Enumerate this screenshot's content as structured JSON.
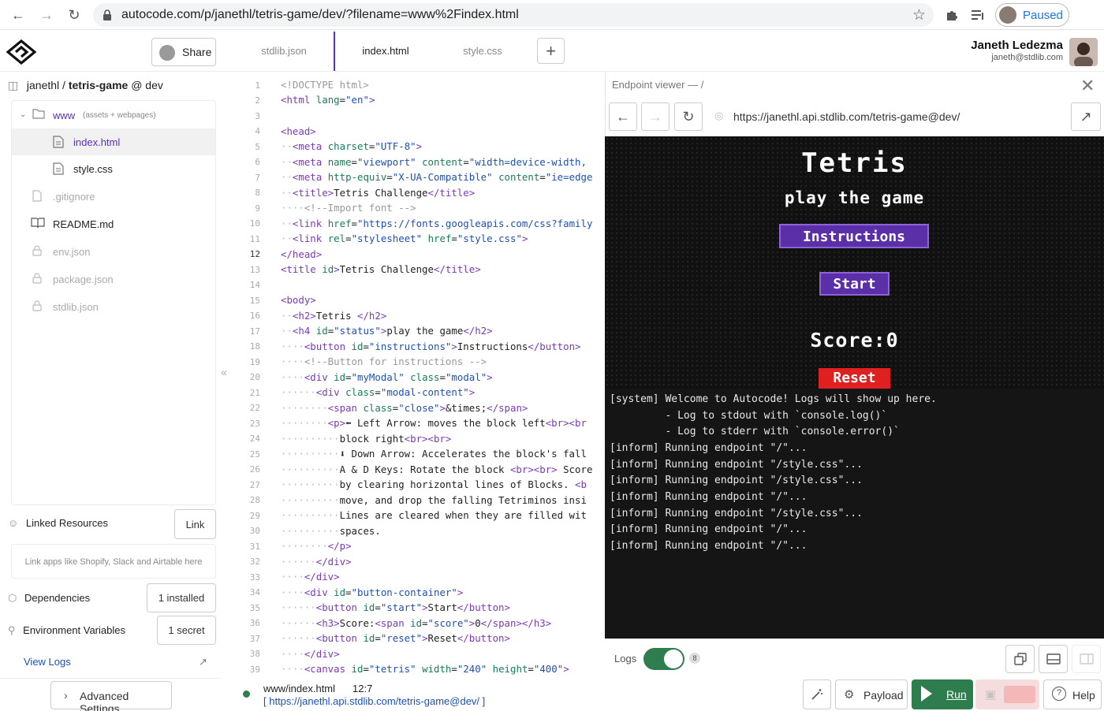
{
  "browser": {
    "url": "autocode.com/p/janethl/tetris-game/dev/?filename=www%2Findex.html",
    "profile_label": "Paused"
  },
  "header": {
    "share_label": "Share",
    "tabs": [
      {
        "label": "stdlib.json"
      },
      {
        "label": "index.html"
      },
      {
        "label": "style.css"
      }
    ],
    "add_tab": "+",
    "user_name": "Janeth Ledezma",
    "user_email": "janeth@stdlib.com"
  },
  "sidebar": {
    "owner": "janethl",
    "sep": "/",
    "project": "tetris-game",
    "env": "@ dev",
    "folder": {
      "label": "www",
      "hint": "(assets + webpages)"
    },
    "files": [
      {
        "label": "index.html"
      },
      {
        "label": "style.css"
      },
      {
        "label": ".gitignore"
      },
      {
        "label": "README.md"
      },
      {
        "label": "env.json"
      },
      {
        "label": "package.json"
      },
      {
        "label": "stdlib.json"
      }
    ],
    "linked_resources": "Linked Resources",
    "link_btn": "Link",
    "link_hint": "Link apps like Shopify, Slack and Airtable here",
    "dependencies": "Dependencies",
    "deps_btn": "1 installed",
    "env_vars": "Environment Variables",
    "env_btn": "1 secret",
    "view_logs": "View Logs",
    "advanced": "Advanced Settings"
  },
  "editor": {
    "current_line": 12,
    "status_file": "www/index.html",
    "status_pos": "12:7",
    "status_url": "[ https://janethl.api.stdlib.com/tetris-game@dev/ ]"
  },
  "endpoint": {
    "title": "Endpoint viewer — /",
    "url": "https://janethl.api.stdlib.com/tetris-game@dev/",
    "game": {
      "title": "Tetris",
      "subtitle": "play the game",
      "instructions": "Instructions",
      "start": "Start",
      "score": "Score:0",
      "reset": "Reset"
    },
    "console": [
      "[system] Welcome to Autocode! Logs will show up here.",
      "         - Log to stdout with `console.log()`",
      "         - Log to stderr with `console.error()`",
      "[inform] Running endpoint \"/\"...",
      "[inform] Running endpoint \"/style.css\"...",
      "[inform] Running endpoint \"/style.css\"...",
      "[inform] Running endpoint \"/\"...",
      "[inform] Running endpoint \"/style.css\"...",
      "[inform] Running endpoint \"/\"...",
      "[inform] Running endpoint \"/\"..."
    ],
    "logs_label": "Logs",
    "logs_count": "8"
  },
  "actions": {
    "payload": "Payload",
    "run": "Run",
    "help": "Help"
  },
  "colors": {
    "accent": "#5b2fc4",
    "run_green": "#2e7d4f",
    "reset_red": "#e02020",
    "game_purple": "#5b2fa8"
  }
}
